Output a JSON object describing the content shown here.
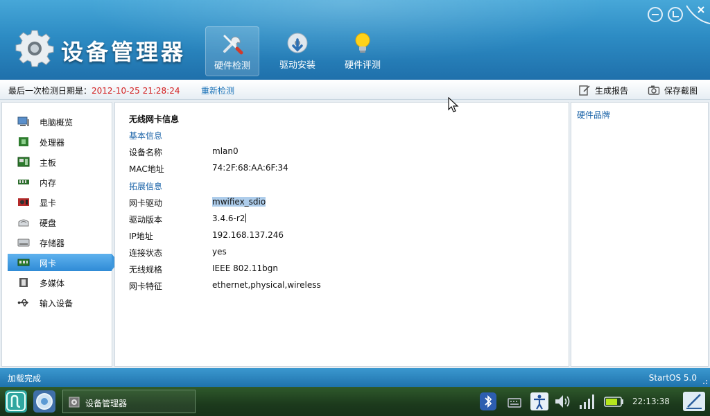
{
  "app": {
    "title": "设备管理器",
    "tabs": [
      {
        "label": "硬件检测",
        "icon": "wrench-screwdriver-icon",
        "active": true
      },
      {
        "label": "驱动安装",
        "icon": "disc-install-icon",
        "active": false
      },
      {
        "label": "硬件评测",
        "icon": "lightbulb-icon",
        "active": false
      }
    ],
    "window_controls": [
      "minimize-icon",
      "restore-icon",
      "close-icon"
    ]
  },
  "infobar": {
    "date_label": "最后一次检测日期是：",
    "date_value": "2012-10-25 21:28:24",
    "recheck": "重新检测",
    "generate_report": "生成报告",
    "save_screenshot": "保存截图"
  },
  "sidebar": {
    "items": [
      {
        "label": "电脑概览",
        "icon": "computer-icon"
      },
      {
        "label": "处理器",
        "icon": "cpu-icon"
      },
      {
        "label": "主板",
        "icon": "motherboard-icon"
      },
      {
        "label": "内存",
        "icon": "memory-icon"
      },
      {
        "label": "显卡",
        "icon": "graphics-card-icon"
      },
      {
        "label": "硬盘",
        "icon": "hard-disk-icon"
      },
      {
        "label": "存储器",
        "icon": "storage-icon"
      },
      {
        "label": "网卡",
        "icon": "network-card-icon",
        "active": true
      },
      {
        "label": "多媒体",
        "icon": "multimedia-icon"
      },
      {
        "label": "输入设备",
        "icon": "usb-icon"
      }
    ]
  },
  "content": {
    "section_title": "无线网卡信息",
    "basic_title": "基本信息",
    "basic_rows": [
      {
        "key": "设备名称",
        "value": "mlan0"
      },
      {
        "key": "MAC地址",
        "value": "74:2F:68:AA:6F:34"
      }
    ],
    "ext_title": "拓展信息",
    "ext_rows": [
      {
        "key": "网卡驱动",
        "value": "mwifiex_sdio"
      },
      {
        "key": "驱动版本",
        "value": "3.4.6-r2"
      },
      {
        "key": "IP地址",
        "value": "192.168.137.246"
      },
      {
        "key": "连接状态",
        "value": "yes"
      },
      {
        "key": "无线规格",
        "value": "IEEE 802.11bgn"
      },
      {
        "key": "网卡特征",
        "value": "ethernet,physical,wireless"
      }
    ]
  },
  "brand_panel": {
    "title": "硬件品牌"
  },
  "status": {
    "left": "加载完成",
    "right": "StartOS 5.0"
  },
  "taskbar": {
    "task_label": "设备管理器",
    "clock": "22:13:38",
    "tray_icons": [
      "bluetooth-icon",
      "keyboard-icon",
      "accessibility-icon",
      "volume-icon",
      "signal-icon",
      "battery-icon"
    ],
    "accent_color": "#2f8bd6"
  }
}
